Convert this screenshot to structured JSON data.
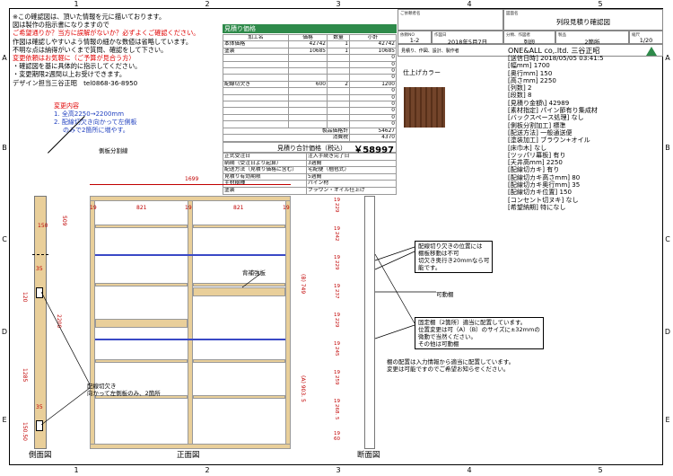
{
  "ruler": {
    "top": [
      "1",
      "2",
      "3",
      "4",
      "5"
    ],
    "side": [
      "A",
      "B",
      "C",
      "D",
      "E"
    ]
  },
  "notes": {
    "line1": "※この確認図は、頂いた情報を元に描いております。",
    "line2": "図は製作の指示書になりますので",
    "line3": "ご希望通りか？当方に誤解がないか？必ずよくご確認ください。",
    "line4": "作図は確認しやすいよう情報の細かな数値は省略しています。",
    "line5": "不明な点は納得がいくまで質問、確認をして下さい。",
    "line6": "変更依頼はお気軽に（ご予算が見合う方）",
    "line7": "・確認図を基に具体的に指示してください。",
    "line8": "・変更期限2週間以上お受けできます。",
    "line9": "デザイン担当三谷正昭　tel0868-36-8950",
    "change_title": "変更内容",
    "change1": "1.  全高2250→2200mm",
    "change2": "2.  配線切欠き向かって左側板",
    "change3": "のみで2箇所に増やす。"
  },
  "estimate": {
    "title": "見積り価格",
    "headers": [
      "加工名",
      "価格",
      "数量",
      "小計"
    ],
    "rows": [
      [
        "本体価格",
        "42742",
        "1",
        "42742"
      ],
      [
        "塗装",
        "10685",
        "1",
        "10685"
      ],
      [
        "",
        "",
        "",
        "0"
      ],
      [
        "",
        "",
        "",
        "0"
      ],
      [
        "",
        "",
        "",
        "0"
      ],
      [
        "",
        "",
        "",
        "0"
      ],
      [
        "配線切欠き",
        "600",
        "2",
        "1200"
      ],
      [
        "",
        "",
        "",
        "0"
      ],
      [
        "",
        "",
        "",
        "0"
      ],
      [
        "",
        "",
        "",
        "0"
      ],
      [
        "",
        "",
        "",
        "0"
      ],
      [
        "",
        "",
        "",
        "0"
      ],
      [
        "",
        "",
        "",
        "0"
      ]
    ],
    "product_total_label": "製品価格計",
    "product_total": "54627",
    "tax_label": "消費税",
    "tax": "4370",
    "grand_label": "見積り合計価格（税込）",
    "grand_value": "￥58997",
    "info": [
      [
        "正式受注日",
        "注入手続き完了日"
      ],
      [
        "納期（受注日より起算）",
        "3週間"
      ],
      [
        "配送方法（見積り価格に含む）",
        "宅配便（梱包式）"
      ],
      [
        "見積り有効期限",
        "5週間"
      ],
      [
        "主材樹種",
        "パイン材"
      ],
      [
        "塗装",
        "ブラウン・オイル仕上げ"
      ]
    ]
  },
  "title_block": {
    "customer_label": "ご依頼者名",
    "drawing_name_label": "図面名",
    "drawing_name": "列段見積り確認図",
    "request_no_label": "依頼NO",
    "request_no": "1-2",
    "date_label": "作図日",
    "date": "2018年5月7日",
    "category_label": "分類、作図者",
    "category": "列段",
    "product_label": "製品",
    "product": "2箇所",
    "scale_label": "縮尺",
    "scale": "1/20",
    "maker_caption": "見積り、作図、設計、製作者",
    "maker": "ONE&ALL co,.ltd. 三谷正昭"
  },
  "finish": {
    "label": "仕上げカラー",
    "color": "#6b3a1f"
  },
  "spec": [
    "[送信日時] 2018/05/05 03:41:5",
    "[幅mm] 1700",
    "[奥行mm] 150",
    "[高さmm] 2250",
    "[列数] 2",
    "[段数] 8",
    "[見積り金額\\] 42989",
    "[素材指定] パイン節有り集成材",
    "[バックスペース処理] なし",
    "[側板分割加工] 標準",
    "[配送方法] 一般通送便",
    "[塗装加工] ブラウン+オイル",
    "[床巾木] なし",
    "[ツッパリ幕板] 有り",
    "[天井高mm] 2250",
    "[配線切カキ] 有り",
    "[配線切カキ高さmm] 80",
    "[配線切カキ奥行mm] 35",
    "[配線切カキ位置] 150",
    "[コンセント切ヌキ] なし",
    "[希望納期] 特になし"
  ],
  "drawing": {
    "side_view": "側面図",
    "front_view": "正面図",
    "section_view": "断面図",
    "label_side_split": "側板分割線",
    "label_back_rail": "背補強板",
    "label_cut": "配線切欠き",
    "label_cut2": "向かって左側板のみ、2箇所",
    "label_movable": "可動棚",
    "annot1": [
      "配線切り欠きの位置には",
      "棚板移動は不可",
      "切欠き奥行き20mmなら可",
      "能です。"
    ],
    "annot2": [
      "固定棚（2箇所）適当に配置しています。",
      "位置変更は可（A）（B）のサイズに±32mmの",
      "微動で当然ください。",
      "その他は可動棚"
    ],
    "annot3": [
      "棚の配置は入力情報から適当に配置しています。",
      "変更は可能ですのでご希望お知らせください。"
    ],
    "dims": {
      "width": "1699",
      "pitch1": "821",
      "pitch2": "821",
      "side19a": "19",
      "side19b": "19",
      "side19c": "19",
      "depth150": "150",
      "h509": "509",
      "h2200": "2200",
      "h120": "120",
      "h35a": "35",
      "h35b": "35",
      "h1285": "1285",
      "h150_5": "150.50",
      "b749": "(B) 749",
      "a903": "(A) 903. 5",
      "sec": [
        "19",
        "229",
        "19",
        "242",
        "19",
        "229",
        "19",
        "237",
        "19",
        "229",
        "19",
        "245",
        "19",
        "259",
        "19",
        "268. 5",
        "19",
        "60"
      ]
    }
  }
}
